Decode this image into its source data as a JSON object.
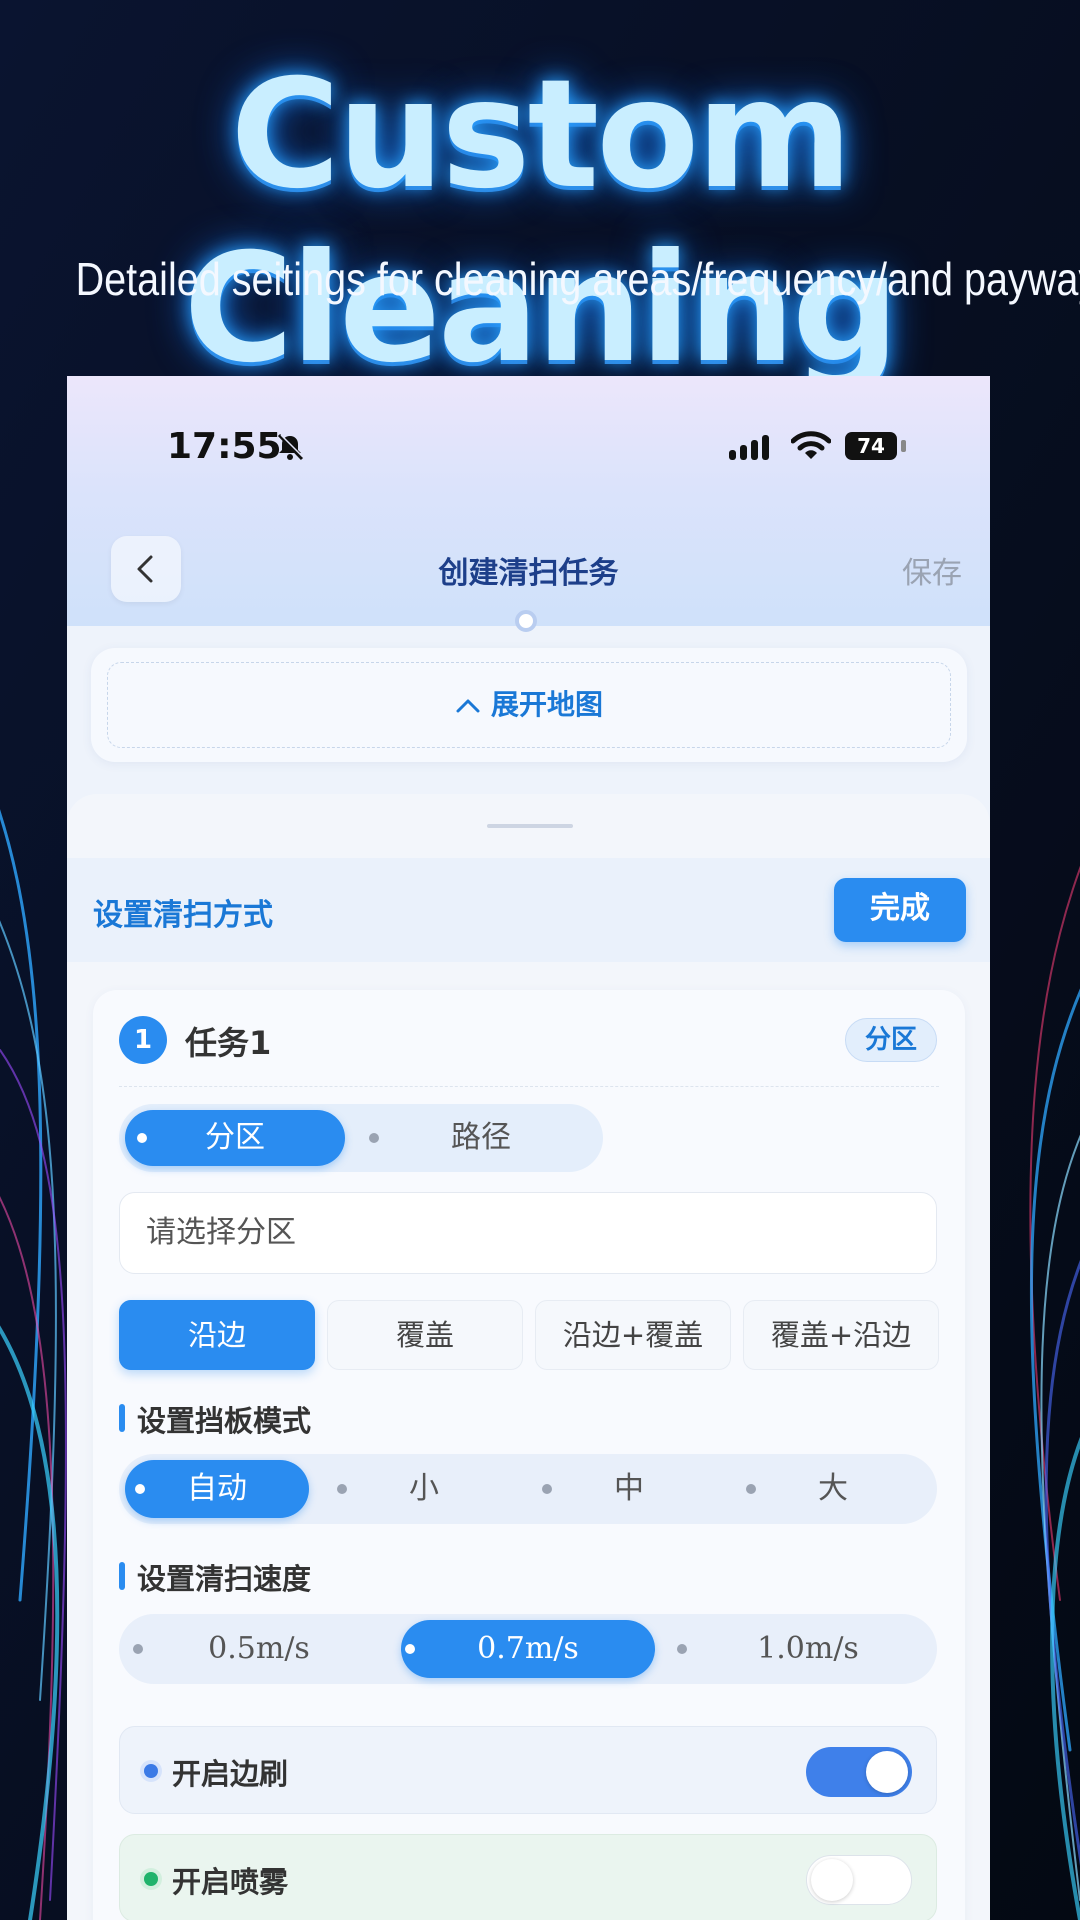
{
  "hero": {
    "title": "Custom Cleaning",
    "subtitle": "Detailed seitings for cleaning areas/frequency/and payways"
  },
  "status_bar": {
    "time": "17:55",
    "battery": "74",
    "icons": [
      "bell-slash-icon",
      "signal-icon",
      "wifi-icon",
      "battery-icon"
    ]
  },
  "nav": {
    "back_icon": "chevron-left-icon",
    "title": "创建清扫任务",
    "save_label": "保存"
  },
  "map": {
    "expand_label": "展开地图",
    "icon": "chevron-up-icon"
  },
  "mode": {
    "title": "设置清扫方式",
    "done_label": "完成"
  },
  "task": {
    "number": "1",
    "name": "任务1",
    "badge": "分区",
    "type_tabs": [
      {
        "label": "分区",
        "active": true
      },
      {
        "label": "路径",
        "active": false
      }
    ],
    "zone_placeholder": "请选择分区",
    "methods": [
      {
        "label": "沿边",
        "active": true
      },
      {
        "label": "覆盖",
        "active": false
      },
      {
        "label": "沿边+覆盖",
        "active": false
      },
      {
        "label": "覆盖+沿边",
        "active": false
      }
    ],
    "baffle": {
      "label": "设置挡板模式",
      "options": [
        {
          "label": "自动",
          "active": true
        },
        {
          "label": "小",
          "active": false
        },
        {
          "label": "中",
          "active": false
        },
        {
          "label": "大",
          "active": false
        }
      ]
    },
    "speed": {
      "label": "设置清扫速度",
      "options": [
        {
          "label": "0.5m/s",
          "active": false
        },
        {
          "label": "0.7m/s",
          "active": true
        },
        {
          "label": "1.0m/s",
          "active": false
        }
      ]
    },
    "side_brush": {
      "label": "开启边刷",
      "on": true
    },
    "spray": {
      "label": "开启喷雾",
      "on": false
    }
  },
  "colors": {
    "accent": "#2a8cf0",
    "title_blue": "#1a78d6",
    "brush_dot": "#3b7ae6",
    "spray_dot": "#1fb36b",
    "switch_on": "#3f80ea",
    "switch_off": "#ffffff"
  }
}
